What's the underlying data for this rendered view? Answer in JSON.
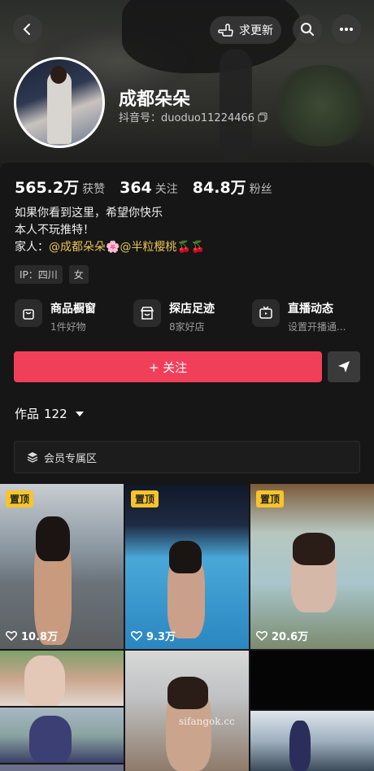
{
  "header": {
    "update_label": "求更新"
  },
  "profile": {
    "name": "成都朵朵",
    "douyin_id": "抖音号：duoduo11224466"
  },
  "stats": [
    {
      "value": "565.2万",
      "label": "获赞"
    },
    {
      "value": "364",
      "label": "关注"
    },
    {
      "value": "84.8万",
      "label": "粉丝"
    }
  ],
  "bio": {
    "line1": "如果你看到这里，希望你快乐",
    "line2": "本人不玩推特！",
    "line3_prefix": "家人：",
    "link1": "@成都朵朵",
    "emoji1": "🌸",
    "link2": "@半粒樱桃",
    "emoji2": "🍒🍒"
  },
  "tags": [
    "IP：四川",
    "女"
  ],
  "features": [
    {
      "title": "商品橱窗",
      "sub": "1件好物",
      "icon": "shop-bag-icon"
    },
    {
      "title": "探店足迹",
      "sub": "8家好店",
      "icon": "store-icon"
    },
    {
      "title": "直播动态",
      "sub": "设置开播通...",
      "icon": "tv-icon"
    }
  ],
  "follow_label": "+ 关注",
  "works": {
    "label": "作品",
    "count": "122"
  },
  "member_zone_label": "会员专属区",
  "grid": [
    {
      "pin": "置顶",
      "likes": "10.8万"
    },
    {
      "pin": "置顶",
      "likes": "9.3万"
    },
    {
      "pin": "置顶",
      "likes": "20.6万"
    }
  ],
  "watermark": "sifangok.cc",
  "colors": {
    "accent": "#f13f5a",
    "pin": "#f7c42a",
    "link": "#e6c253"
  }
}
